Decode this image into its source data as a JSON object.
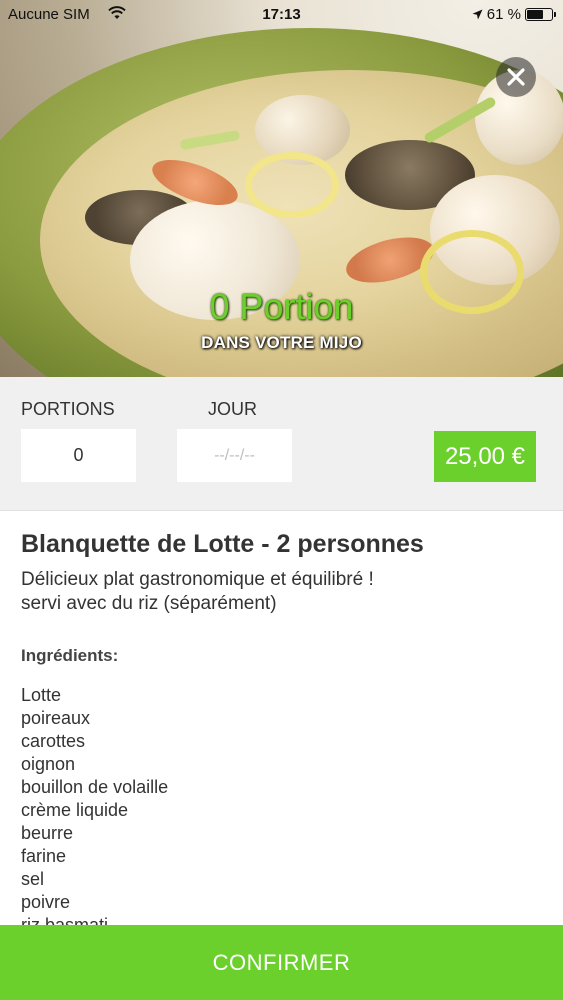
{
  "status_bar": {
    "carrier": "Aucune SIM",
    "time": "17:13",
    "battery": "61 %",
    "battery_level": 0.61
  },
  "hero": {
    "portion_title": "0 Portion",
    "portion_subtitle": "DANS VOTRE MIJO",
    "close_icon": "close-icon"
  },
  "form": {
    "portions_label": "PORTIONS",
    "jour_label": "JOUR",
    "portions_value": "0",
    "jour_placeholder": "--/--/--",
    "price": "25,00 €"
  },
  "dish": {
    "title": "Blanquette de Lotte - 2 personnes",
    "description_line1": "Délicieux plat gastronomique et équilibré !",
    "description_line2": "servi avec du riz (séparément)",
    "ingredients_title": "Ingrédients:",
    "ingredients": [
      "Lotte",
      "poireaux",
      "carottes",
      "oignon",
      "bouillon de volaille",
      "crème liquide",
      "beurre",
      "farine",
      "sel",
      "poivre",
      "riz basmati"
    ]
  },
  "actions": {
    "confirm_label": "CONFIRMER"
  },
  "colors": {
    "accent": "#6bd02b",
    "form_bg": "#f0f0f0"
  }
}
